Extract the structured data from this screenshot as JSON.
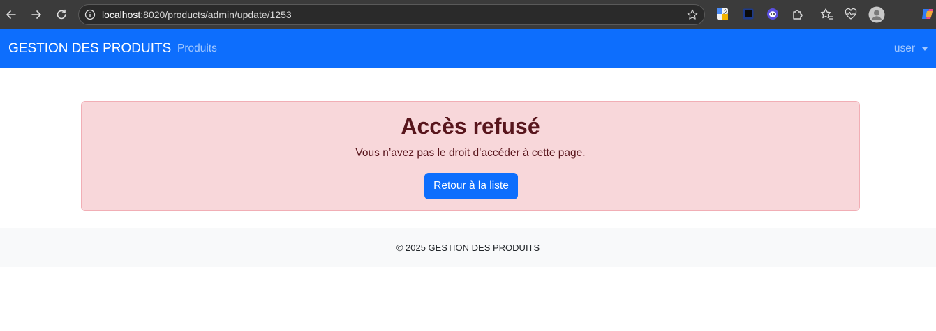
{
  "browser": {
    "url_host": "localhost",
    "url_path": ":8020/products/admin/update/1253",
    "icons": [
      "back-icon",
      "forward-icon",
      "reload-icon",
      "info-icon",
      "bookmark-star-icon",
      "translate-extension-icon",
      "square-extension-icon",
      "ghost-extension-icon",
      "puzzle-extensions-icon",
      "favorites-icon",
      "health-icon",
      "profile-avatar-icon",
      "copilot-icon"
    ]
  },
  "navbar": {
    "brand": "GESTION DES PRODUITS",
    "link_products": "Produits",
    "user": "user",
    "color": "#0d6efd"
  },
  "alert": {
    "title": "Accès refusé",
    "message": "Vous n’avez pas le droit d’accéder à cette page.",
    "button": "Retour à la liste",
    "background": "#f8d7da",
    "text_color": "#58151c"
  },
  "footer": {
    "text": "© 2025 GESTION DES PRODUITS"
  }
}
